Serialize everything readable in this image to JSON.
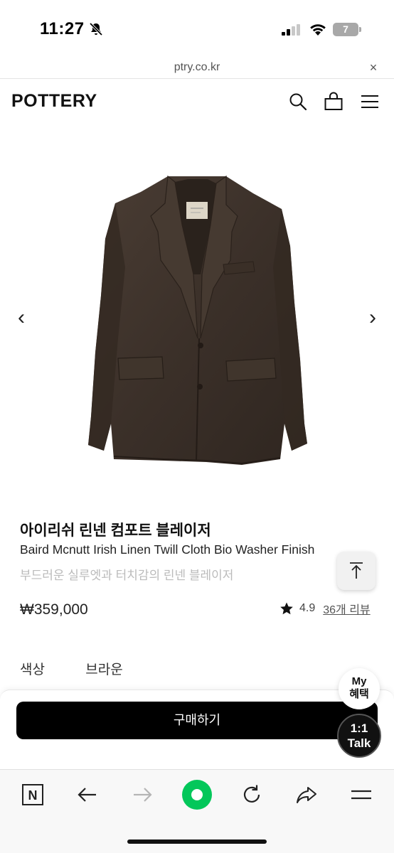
{
  "status_bar": {
    "time": "11:27",
    "battery_level": "7",
    "icons": [
      "bell-slash-icon",
      "signal-icon",
      "wifi-icon",
      "battery-icon"
    ]
  },
  "browser": {
    "url": "ptry.co.kr",
    "close_label": "×"
  },
  "header": {
    "logo": "POTTERY",
    "icons": [
      "search-icon",
      "bag-icon",
      "menu-icon"
    ]
  },
  "gallery": {
    "prev_label": "‹",
    "next_label": "›",
    "image": "brown-linen-blazer-photo"
  },
  "product": {
    "title_ko": "아이리쉬 린넨 컴포트 블레이저",
    "title_en": "Baird Mcnutt Irish Linen Twill Cloth Bio Washer Finish",
    "subtitle": "부드러운 실루엣과 터치감의 린넨 블레이저",
    "price": "₩359,000",
    "rating": "4.9",
    "review_link": "36개 리뷰"
  },
  "options": {
    "color_label": "색상",
    "color_value": "브라운"
  },
  "purchase": {
    "buy_label": "구매하기"
  },
  "floating": {
    "my_benefit_line1": "My",
    "my_benefit_line2": "혜택",
    "talk_line1": "1:1",
    "talk_line2": "Talk"
  },
  "toolbar": {
    "icons": [
      "naver-n-icon",
      "back-arrow-icon",
      "forward-arrow-icon",
      "green-home-icon",
      "refresh-icon",
      "share-icon",
      "menu-icon"
    ],
    "n_label": "N"
  },
  "colors": {
    "jacket": "#3f332b",
    "accent_green": "#03c75a",
    "buy_button": "#000000"
  }
}
